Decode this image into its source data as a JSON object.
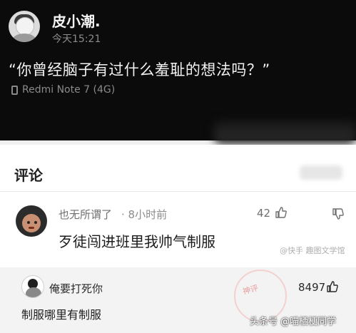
{
  "post": {
    "author": "皮小潮.",
    "time": "今天15:21",
    "text": "“你曾经脑子有过什么羞耻的想法吗？”",
    "device": "Redmi Note 7 (4G)"
  },
  "comments": {
    "title": "评论",
    "items": [
      {
        "user": "也无所谓了",
        "time": "· 8小时前",
        "text": "歹徒闯进班里我帅气制服",
        "likes": "42"
      }
    ],
    "watermark": "@快手 趣图文学馆"
  },
  "reply": {
    "user": "俺要打死你",
    "text": "制服哪里有制服",
    "likes": "8497",
    "stamp": "神评"
  },
  "footer_watermark": "头条号 @喵栖梗同学",
  "colors": {
    "post_bg": "#0b0b0c",
    "panel_bg": "#ffffff",
    "reply_bg": "#f3f3f3"
  }
}
